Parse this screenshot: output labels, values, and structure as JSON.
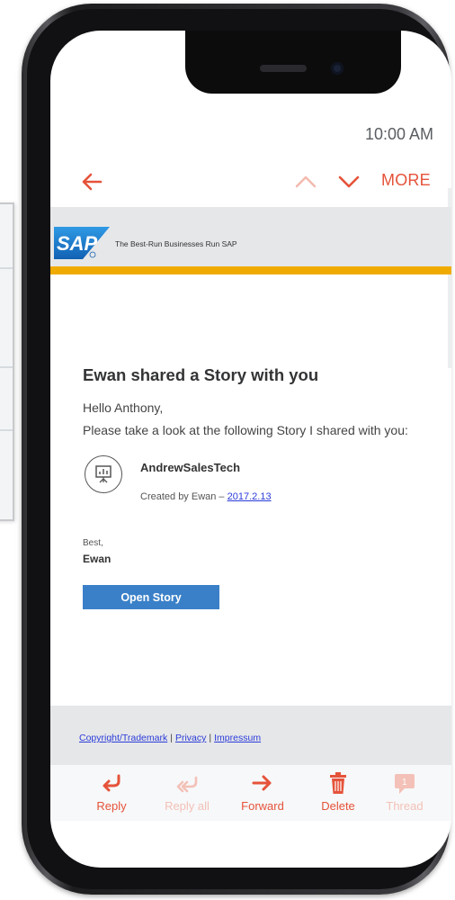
{
  "status_bar": {
    "time": "10:00 AM"
  },
  "toolbar": {
    "back_icon": "arrow-left-icon",
    "previous_icon": "chevron-up-icon",
    "next_icon": "chevron-down-icon",
    "more_label": "MORE"
  },
  "email": {
    "brand": {
      "logo_text": "SAP",
      "tagline": "The Best-Run Businesses Run SAP"
    },
    "title": "Ewan shared a Story with you",
    "greeting": "Hello Anthony,",
    "message": "Please take a look at the following Story I shared with you:",
    "story": {
      "icon": "presentation-icon",
      "name": "AndrewSalesTech",
      "created_by": "Created by Ewan –",
      "date": "2017.2.13"
    },
    "signoff": {
      "best": "Best,",
      "name": "Ewan"
    },
    "open_button_label": "Open Story",
    "footer_links": [
      "Copyright/Trademark",
      "Privacy",
      "Impressum"
    ]
  },
  "actions": [
    {
      "label": "Reply",
      "icon": "reply-icon",
      "enabled": true
    },
    {
      "label": "Reply all",
      "icon": "reply-all-icon",
      "enabled": false
    },
    {
      "label": "Forward",
      "icon": "forward-icon",
      "enabled": true
    },
    {
      "label": "Delete",
      "icon": "trash-icon",
      "enabled": true
    },
    {
      "label": "Thread",
      "icon": "thread-icon",
      "enabled": false
    }
  ],
  "colors": {
    "accent": "#e5533a",
    "sap_blue": "#1d7fd0",
    "sap_gold": "#f0ab00",
    "button_blue": "#3a80c8",
    "link_blue": "#2a3bd8"
  }
}
